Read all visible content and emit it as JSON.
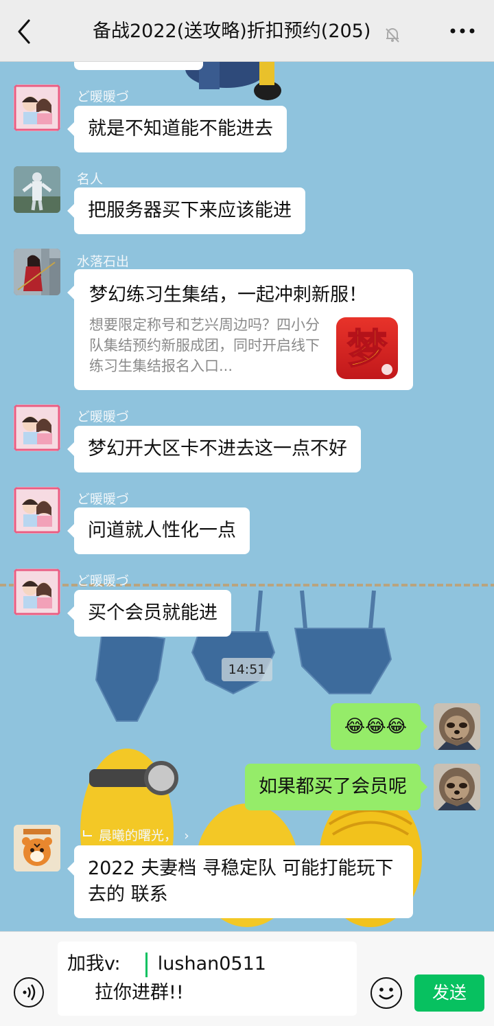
{
  "header": {
    "title": "备战2022(送攻略)折扣预约(205)"
  },
  "messages": {
    "m1": {
      "nick": "ど暖暖づ",
      "text": "就是不知道能不能进去"
    },
    "m2": {
      "nick": "名人",
      "text": "把服务器买下来应该能进"
    },
    "m3": {
      "nick": "水落石出",
      "card_title": "梦幻练习生集结，一起冲刺新服！",
      "card_desc": "想要限定称号和艺兴周边吗？四小分队集结预约新服成团，同时开启线下练习生集结报名入口...",
      "icon_char": "梦"
    },
    "m4": {
      "nick": "ど暖暖づ",
      "text": "梦幻开大区卡不进去这一点不好"
    },
    "m5": {
      "nick": "ど暖暖づ",
      "text": "问道就人性化一点"
    },
    "m6": {
      "nick": "ど暖暖づ",
      "text": "买个会员就能进"
    },
    "time": "14:51",
    "m7": {
      "text": "😂😂😂"
    },
    "m8": {
      "text": "如果都买了会员呢"
    },
    "m9": {
      "quote_ref": "晨曦的曙光，",
      "text": "2022 夫妻档 寻稳定队 可能打能玩下去的 联系"
    }
  },
  "composer": {
    "line1_prefix": "加我v:",
    "line1_value": "lushan0511",
    "line2": "拉你进群!!",
    "send_label": "发送"
  },
  "colors": {
    "chat_bg": "#8fc3dd",
    "me_bubble": "#95ec69",
    "send_button": "#07c160"
  }
}
